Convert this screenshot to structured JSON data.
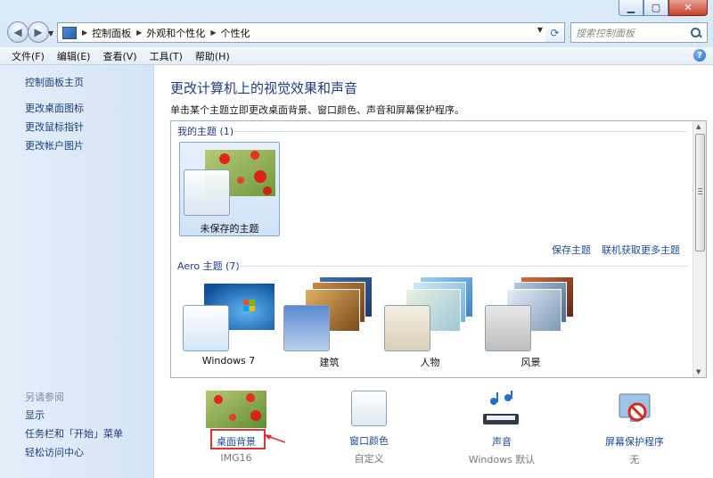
{
  "breadcrumb": [
    "控制面板",
    "外观和个性化",
    "个性化"
  ],
  "search": {
    "placeholder": "搜索控制面板"
  },
  "menu": [
    "文件(F)",
    "编辑(E)",
    "查看(V)",
    "工具(T)",
    "帮助(H)"
  ],
  "sidebar": {
    "links": [
      "控制面板主页",
      "更改桌面图标",
      "更改鼠标指针",
      "更改帐户图片"
    ],
    "see_also_title": "另请参阅",
    "see_also": [
      "显示",
      "任务栏和「开始」菜单",
      "轻松访问中心"
    ]
  },
  "main": {
    "title": "更改计算机上的视觉效果和声音",
    "subtitle": "单击某个主题立即更改桌面背景、窗口颜色、声音和屏幕保护程序。",
    "my_themes": {
      "label": "我的主题 (1)",
      "items": [
        "未保存的主题"
      ]
    },
    "save_theme": "保存主题",
    "get_more": "联机获取更多主题",
    "aero_themes": {
      "label": "Aero 主题 (7)",
      "items": [
        "Windows 7",
        "建筑",
        "人物",
        "风景"
      ]
    }
  },
  "settings": [
    {
      "label": "桌面背景",
      "value": "IMG16"
    },
    {
      "label": "窗口颜色",
      "value": "自定义"
    },
    {
      "label": "声音",
      "value": "Windows 默认"
    },
    {
      "label": "屏幕保护程序",
      "value": "无"
    }
  ],
  "colors": {
    "link": "#1c4b9a",
    "heading": "#1e3a8a",
    "highlight": "#e53030"
  }
}
